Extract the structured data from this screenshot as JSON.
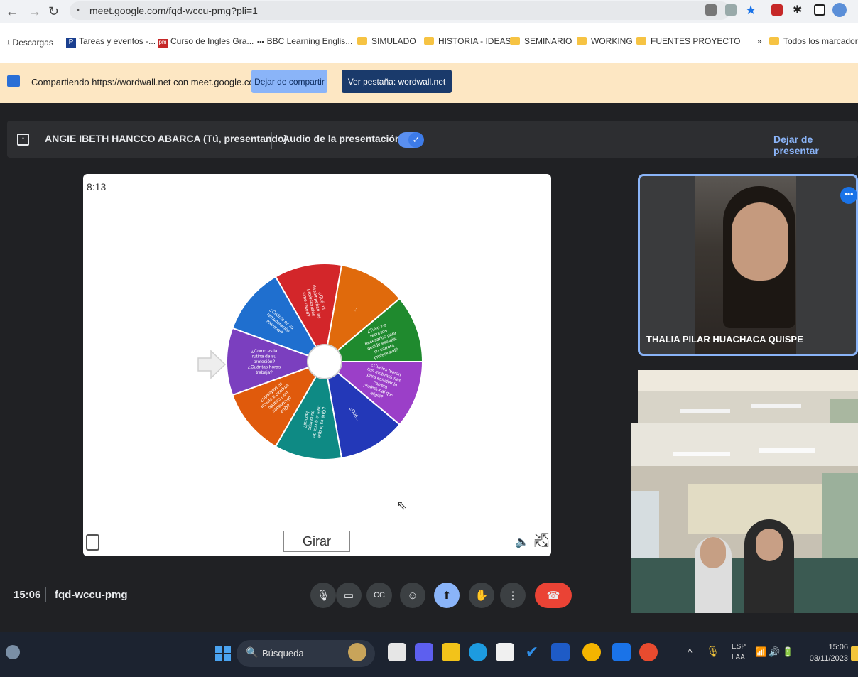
{
  "browser": {
    "url": "meet.google.com/fqd-wccu-pmg?pli=1",
    "bookmarks": [
      {
        "label": "Descargas",
        "icon": "download-icon"
      },
      {
        "label": "Tareas y eventos -...",
        "icon": "tasks-icon"
      },
      {
        "label": "Curso de Ingles Gra...",
        "icon": "pm-icon"
      },
      {
        "label": "BBC Learning Englis...",
        "icon": "bbc-icon"
      },
      {
        "label": "SIMULADO",
        "icon": "folder-icon"
      },
      {
        "label": "HISTORIA - IDEAS",
        "icon": "folder-icon"
      },
      {
        "label": "SEMINARIO",
        "icon": "folder-icon"
      },
      {
        "label": "WORKING",
        "icon": "folder-icon"
      },
      {
        "label": "FUENTES PROYECTO",
        "icon": "folder-icon"
      }
    ],
    "more_bookmarks": "»",
    "all_bookmarks": "Todos los marcadores"
  },
  "share_banner": {
    "text": "Compartiendo https://wordwall.net con meet.google.com",
    "stop_sharing": "Dejar de compartir",
    "view_tab": "Ver pestaña: wordwall.net"
  },
  "present_bar": {
    "presenter": "ANGIE IBETH HANCCO ABARCA (Tú, presentando)",
    "audio_label": "Audio de la presentación",
    "audio_enabled": true,
    "stop_presenting": "Dejar de presentar"
  },
  "wordwall": {
    "timer": "8:13",
    "spin_label": "Girar",
    "wheel_segments": [
      {
        "color": "#7b3fbf",
        "text": "¿Cómo es la rutina de su profesión? ¿Cuántas horas trabaja?"
      },
      {
        "color": "#1f6fcf",
        "text": "¿Cuánto es su remuneración mensual?"
      },
      {
        "color": "#d3262a",
        "text": "¿Qué rol desempeñan los profesionales como usted?"
      },
      {
        "color": "#e06a0c",
        "text": "..."
      },
      {
        "color": "#1f8a2e",
        "text": "¿Tuvo los recursos necesarios para decidir estudiar su carrera profesional?"
      },
      {
        "color": "#9b3fc8",
        "text": "¿Cuáles fueron sus motivaciones para estudiar la carrera profesional que eligió?"
      },
      {
        "color": "#2338b8",
        "text": "¿Qué..."
      },
      {
        "color": "#0e8a84",
        "text": "¿Qué es lo que más le gusta de su campo laboral?"
      },
      {
        "color": "#e05a0c",
        "text": "¿Qué dificultades tuvo cuando empezó a ejercer su profesión?"
      }
    ]
  },
  "participants": [
    {
      "name": "THALIA PILAR HUACHACA QUISPE"
    }
  ],
  "meeting": {
    "time": "15:06",
    "code": "fqd-wccu-pmg",
    "controls": [
      {
        "name": "mic-button",
        "icon": "mic-icon",
        "glyph": "🎙"
      },
      {
        "name": "camera-button",
        "icon": "camera-icon",
        "glyph": "▭"
      },
      {
        "name": "captions-button",
        "icon": "captions-icon",
        "glyph": "CC"
      },
      {
        "name": "emoji-button",
        "icon": "emoji-icon",
        "glyph": "☺"
      },
      {
        "name": "present-button",
        "icon": "present-icon",
        "glyph": "⬆"
      },
      {
        "name": "raise-hand-button",
        "icon": "hand-icon",
        "glyph": "✋"
      },
      {
        "name": "more-options-button",
        "icon": "more-vert-icon",
        "glyph": "⋮"
      },
      {
        "name": "leave-call-button",
        "icon": "phone-hangup-icon",
        "glyph": "☎"
      }
    ],
    "leave_color": "#ea4335",
    "active_color": "#8ab4f8"
  },
  "taskbar": {
    "search_placeholder": "Búsqueda",
    "language_line1": "ESP",
    "language_line2": "LAA",
    "clock_time": "15:06",
    "clock_date": "03/11/2023"
  }
}
